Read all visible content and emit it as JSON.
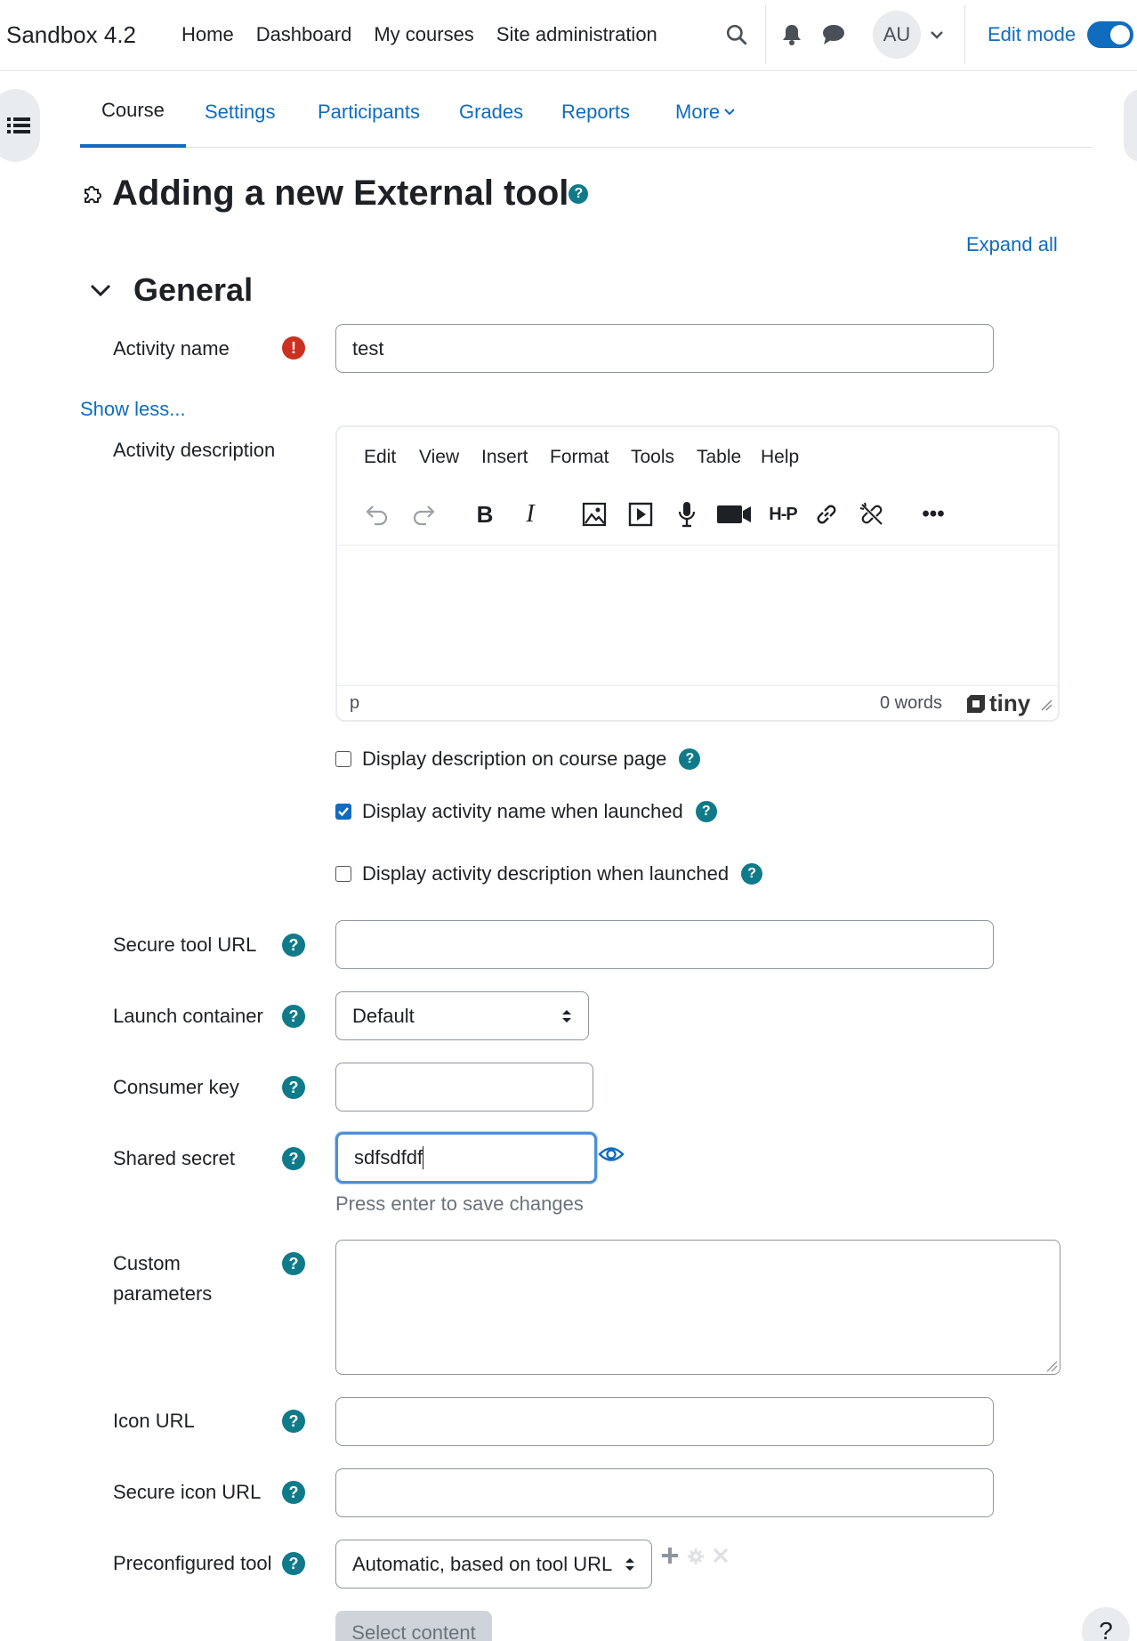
{
  "navbar": {
    "brand": "Sandbox 4.2",
    "links": [
      "Home",
      "Dashboard",
      "My courses",
      "Site administration"
    ],
    "avatar_initials": "AU",
    "edit_mode_label": "Edit mode",
    "edit_mode_on": true
  },
  "secondary_nav": {
    "tabs": [
      "Course",
      "Settings",
      "Participants",
      "Grades",
      "Reports",
      "More"
    ],
    "active_tab": "Course"
  },
  "page": {
    "title": "Adding a new External tool",
    "expand_all": "Expand all",
    "section_title": "General",
    "show_less": "Show less..."
  },
  "form": {
    "activity_name_label": "Activity name",
    "activity_name_value": "test",
    "activity_description_label": "Activity description",
    "editor": {
      "menu": [
        "Edit",
        "View",
        "Insert",
        "Format",
        "Tools",
        "Table",
        "Help"
      ],
      "status_path": "p",
      "word_count": "0 words",
      "brand": "tiny"
    },
    "checkboxes": [
      {
        "label": "Display description on course page",
        "checked": false
      },
      {
        "label": "Display activity name when launched",
        "checked": true
      },
      {
        "label": "Display activity description when launched",
        "checked": false
      }
    ],
    "secure_tool_url_label": "Secure tool URL",
    "secure_tool_url_value": "",
    "launch_container_label": "Launch container",
    "launch_container_value": "Default",
    "consumer_key_label": "Consumer key",
    "consumer_key_value": "",
    "shared_secret_label": "Shared secret",
    "shared_secret_value": "sdfsdfdf",
    "shared_secret_hint": "Press enter to save changes",
    "custom_parameters_label": "Custom parameters",
    "icon_url_label": "Icon URL",
    "secure_icon_url_label": "Secure icon URL",
    "preconfigured_tool_label": "Preconfigured tool",
    "preconfigured_tool_value": "Automatic, based on tool URL",
    "select_content_button": "Select content"
  },
  "help_fab": "?",
  "colors": {
    "accent": "#0f6cbf",
    "help_icon": "#0f7b8a",
    "required_icon": "#ca3120"
  }
}
